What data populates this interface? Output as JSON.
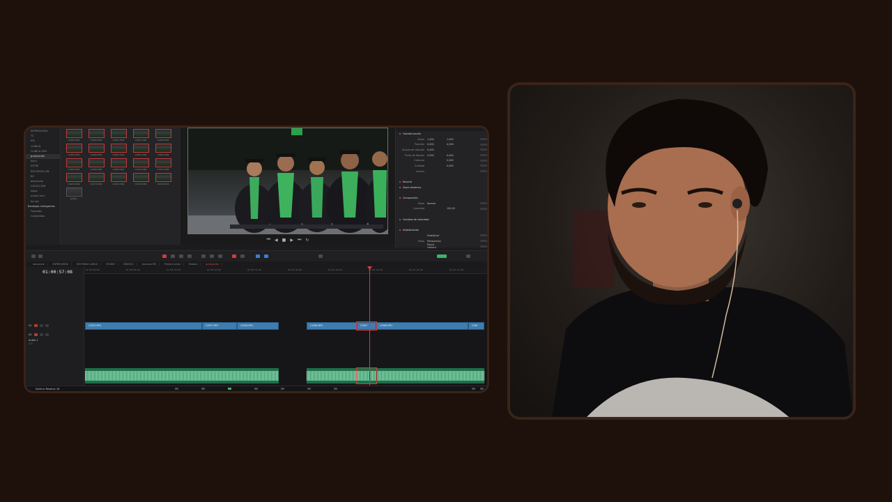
{
  "editor": {
    "bins": [
      {
        "label": "ENTREVISTAS",
        "style": "normal"
      },
      {
        "label": "TC",
        "style": "normal"
      },
      {
        "label": "IFB",
        "style": "normal"
      },
      {
        "label": "CLINICA",
        "style": "normal"
      },
      {
        "label": "CLINICA 2DO",
        "style": "normal"
      },
      {
        "label": "graduación",
        "style": "active"
      },
      {
        "label": "beca",
        "style": "normal"
      },
      {
        "label": "ESTIM",
        "style": "normal"
      },
      {
        "label": "RECURSOS UN",
        "style": "normal"
      },
      {
        "label": "BE",
        "style": "normal"
      },
      {
        "label": "desarrollo",
        "style": "normal"
      },
      {
        "label": "COLECCIÓN",
        "style": "normal"
      },
      {
        "label": "logos",
        "style": "normal"
      },
      {
        "label": "outros recu",
        "style": "normal"
      },
      {
        "label": "for ext",
        "style": "normal"
      },
      {
        "label": "Bandejas inteligentes",
        "style": "section"
      },
      {
        "label": "Favoritos",
        "style": "normal"
      },
      {
        "label": "Contenidos",
        "style": "normal"
      }
    ],
    "clips": [
      {
        "name": "C2955.MP4",
        "plain": false
      },
      {
        "name": "C2960.MP4",
        "plain": false
      },
      {
        "name": "C2961.MP4",
        "plain": false
      },
      {
        "name": "C2957.MP4",
        "plain": false
      },
      {
        "name": "C2958.MP4",
        "plain": false
      },
      {
        "name": "C2959.MP4",
        "plain": false
      },
      {
        "name": "C2960.MP4",
        "plain": false
      },
      {
        "name": "C2961.MP4",
        "plain": false
      },
      {
        "name": "C2962.MP4",
        "plain": false
      },
      {
        "name": "C2963.MP4",
        "plain": false
      },
      {
        "name": "C2964.MP4",
        "plain": false
      },
      {
        "name": "C2965.MP4",
        "plain": false
      },
      {
        "name": "C2966.MP4",
        "plain": false
      },
      {
        "name": "C2970.MP4",
        "plain": false
      },
      {
        "name": "C2971.MP4",
        "plain": false
      },
      {
        "name": "C2972.MP4",
        "plain": false
      },
      {
        "name": "C2973.MP4",
        "plain": false
      },
      {
        "name": "C2974.MP4",
        "plain": false
      },
      {
        "name": "C2975.MP4",
        "plain": false
      },
      {
        "name": "C2976.MP4",
        "plain": false
      },
      {
        "name": "gráfico",
        "plain": true
      }
    ],
    "inspector": {
      "rows": [
        {
          "type": "header",
          "label": "Transformación"
        },
        {
          "type": "field",
          "label": "Zoom",
          "v1": "1,000",
          "v2": "1,000"
        },
        {
          "type": "field",
          "label": "Posición",
          "v1": "0,000",
          "v2": "0,000"
        },
        {
          "type": "field",
          "label": "Ángulo de rotación",
          "v1": "0,000",
          "v2": ""
        },
        {
          "type": "field",
          "label": "Punto de fijación",
          "v1": "0,000",
          "v2": "0,000"
        },
        {
          "type": "field",
          "label": "Cabeceo",
          "v1": "",
          "v2": "0,000"
        },
        {
          "type": "field",
          "label": "Guiñada",
          "v1": "",
          "v2": "0,000"
        },
        {
          "type": "field",
          "label": "Invertir",
          "v1": "",
          "v2": ""
        },
        {
          "type": "blank",
          "label": ""
        },
        {
          "type": "header",
          "label": "Recorte"
        },
        {
          "type": "header",
          "label": "Zoom dinámico"
        },
        {
          "type": "blank",
          "label": ""
        },
        {
          "type": "header",
          "label": "Composición"
        },
        {
          "type": "field",
          "label": "Modo",
          "v1": "Normal",
          "v2": ""
        },
        {
          "type": "field",
          "label": "Opacidad",
          "v1": "",
          "v2": "100,00"
        },
        {
          "type": "blank",
          "label": ""
        },
        {
          "type": "header",
          "label": "Cambios de velocidad"
        },
        {
          "type": "blank",
          "label": ""
        },
        {
          "type": "header",
          "label": "Estabilización"
        },
        {
          "type": "field",
          "label": "",
          "v1": "Estabilizar",
          "v2": ""
        },
        {
          "type": "field",
          "label": "Modo",
          "v1": "Perspectiva",
          "v2": ""
        },
        {
          "type": "field",
          "label": "",
          "v1": "Mayor cámara",
          "v2": ""
        },
        {
          "type": "field",
          "label": "",
          "v1": "✓ Zoom",
          "v2": ""
        }
      ]
    },
    "timeline_tabs": [
      {
        "label": "secuencia",
        "active": false
      },
      {
        "label": "ENTREVISTAS",
        "active": false
      },
      {
        "label": "HISTORIAS LARGO",
        "active": false
      },
      {
        "label": "STUDIO",
        "active": false
      },
      {
        "label": "GRÁFICO",
        "active": false
      },
      {
        "label": "recursos IFB",
        "active": false
      },
      {
        "label": "Primera Línea",
        "active": false
      },
      {
        "label": "Historia",
        "active": false
      },
      {
        "label": "graduación",
        "active": true
      }
    ],
    "timecode": "01:00:57:08",
    "ruler_ticks": [
      "01:00:00:00",
      "01:00:08:00",
      "01:00:16:00",
      "01:00:24:00",
      "01:00:32:00",
      "01:00:40:00",
      "01:00:48:00",
      "01:00:56:00",
      "01:01:04:00",
      "01:01:12:00"
    ],
    "tracks": {
      "video": {
        "id": "V1",
        "name": "Vídeo 1"
      },
      "audio": {
        "id": "A1",
        "name": "Audio 1",
        "level": "2.0"
      }
    },
    "video_clips": [
      "C2955.MP4",
      "C2957.MP4",
      "C2958.MP4",
      "C2966.MP4",
      "C2967",
      "C2968.MP4",
      "C296"
    ],
    "app_name": "DaVinci Resolve 18"
  }
}
